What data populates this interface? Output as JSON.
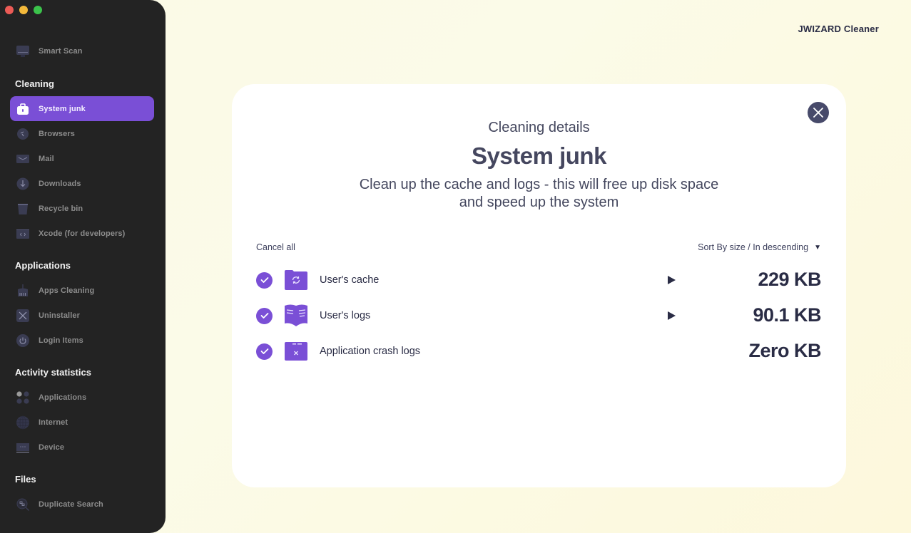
{
  "app": {
    "brand": "JWIZARD Cleaner"
  },
  "window_controls": [
    "close",
    "minimize",
    "zoom"
  ],
  "sidebar": {
    "top_items": [
      {
        "label": "Smart Scan",
        "icon": "monitor-icon"
      }
    ],
    "sections": [
      {
        "title": "Cleaning",
        "items": [
          {
            "label": "System junk",
            "icon": "briefcase-icon",
            "active": true
          },
          {
            "label": "Browsers",
            "icon": "compass-icon"
          },
          {
            "label": "Mail",
            "icon": "envelope-icon"
          },
          {
            "label": "Downloads",
            "icon": "download-icon"
          },
          {
            "label": "Recycle bin",
            "icon": "trash-icon"
          },
          {
            "label": "Xcode (for developers)",
            "icon": "code-icon"
          }
        ]
      },
      {
        "title": "Applications",
        "items": [
          {
            "label": "Apps Cleaning",
            "icon": "broom-icon"
          },
          {
            "label": "Uninstaller",
            "icon": "x-box-icon"
          },
          {
            "label": "Login Items",
            "icon": "power-icon"
          }
        ]
      },
      {
        "title": "Activity statistics",
        "items": [
          {
            "label": "Applications",
            "icon": "grid-dots-icon"
          },
          {
            "label": "Internet",
            "icon": "globe-icon"
          },
          {
            "label": "Device",
            "icon": "laptop-icon"
          }
        ]
      },
      {
        "title": "Files",
        "items": [
          {
            "label": "Duplicate Search",
            "icon": "magnifier-icon"
          }
        ]
      }
    ]
  },
  "panel": {
    "subtitle": "Cleaning details",
    "title": "System junk",
    "description": "Clean up the cache and logs - this will free up disk space and speed up the system",
    "cancel_all": "Cancel all",
    "sort_label": "Sort By size / In descending",
    "items": [
      {
        "label": "User's cache",
        "size": "229 KB",
        "checked": true,
        "expandable": true,
        "icon": "folder-sync-icon"
      },
      {
        "label": "User's logs",
        "size": "90.1 KB",
        "checked": true,
        "expandable": true,
        "icon": "book-icon"
      },
      {
        "label": "Application crash logs",
        "size": "Zero KB",
        "checked": true,
        "expandable": false,
        "icon": "folder-x-icon"
      }
    ]
  },
  "colors": {
    "accent": "#7a4fd6",
    "sidebar_bg": "#232323",
    "text_dark": "#2a2c45",
    "close_button": "#474a6a"
  }
}
